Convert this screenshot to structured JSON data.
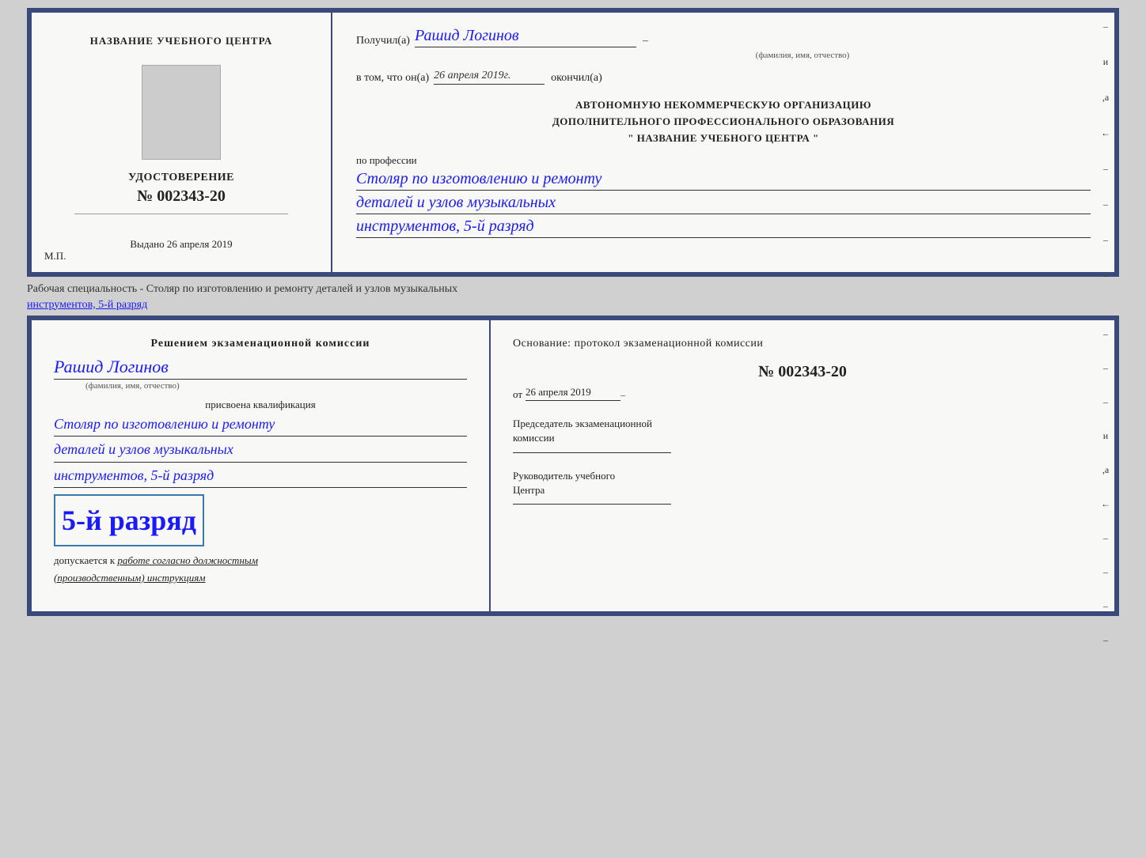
{
  "page": {
    "background": "#d0d0d0"
  },
  "topCert": {
    "left": {
      "title": "НАЗВАНИЕ УЧЕБНОГО ЦЕНТРА",
      "udostoverenie": "УДОСТОВЕРЕНИЕ",
      "number": "№ 002343-20",
      "vydano": "Выдано",
      "vydano_date": "26 апреля 2019",
      "mp": "М.П."
    },
    "right": {
      "poluchil_label": "Получил(а)",
      "poluchil_name": "Рашид Логинов",
      "dash": "–",
      "fio_label": "(фамилия, имя, отчество)",
      "vtom_label": "в том, что он(а)",
      "vtom_date": "26 апреля 2019г.",
      "okoncil": "окончил(а)",
      "org_line1": "АВТОНОМНУЮ НЕКОММЕРЧЕСКУЮ ОРГАНИЗАЦИЮ",
      "org_line2": "ДОПОЛНИТЕЛЬНОГО ПРОФЕССИОНАЛЬНОГО ОБРАЗОВАНИЯ",
      "org_line3": "\"  НАЗВАНИЕ УЧЕБНОГО ЦЕНТРА  \"",
      "po_professii": "по профессии",
      "profession_line1": "Столяр по изготовлению и ремонту",
      "profession_line2": "деталей и узлов музыкальных",
      "profession_line3": "инструментов, 5-й разряд",
      "sidebar_marks": [
        "–",
        "и",
        ",а",
        "←",
        "–",
        "–",
        "–",
        "–"
      ]
    }
  },
  "between": {
    "text1": "Рабочая специальность - Столяр по изготовлению и ремонту деталей и узлов музыкальных",
    "text2": "инструментов, 5-й разряд"
  },
  "bottomCert": {
    "left": {
      "resheniem": "Решением экзаменационной комиссии",
      "name": "Рашид Логинов",
      "fio_label": "(фамилия, имя, отчество)",
      "prisvoena": "присвоена квалификация",
      "profession_line1": "Столяр по изготовлению и ремонту",
      "profession_line2": "деталей и узлов музыкальных",
      "profession_line3": "инструментов, 5-й разряд",
      "razryad_big": "5-й разряд",
      "dopuskaetsya": "допускается к",
      "dopusk_italic": "работе согласно должностным",
      "dopusk_italic2": "(производственным) инструкциям"
    },
    "right": {
      "osnovanie": "Основание: протокол экзаменационной комиссии",
      "protocol_number": "№ 002343-20",
      "ot_label": "от",
      "ot_date": "26 апреля 2019",
      "predsedatel_line1": "Председатель экзаменационной",
      "predsedatel_line2": "комиссии",
      "rukovoditel_line1": "Руководитель учебного",
      "rukovoditel_line2": "Центра",
      "sidebar_marks": [
        "–",
        "–",
        "–",
        "и",
        ",а",
        "←",
        "–",
        "–",
        "–",
        "–"
      ]
    }
  }
}
